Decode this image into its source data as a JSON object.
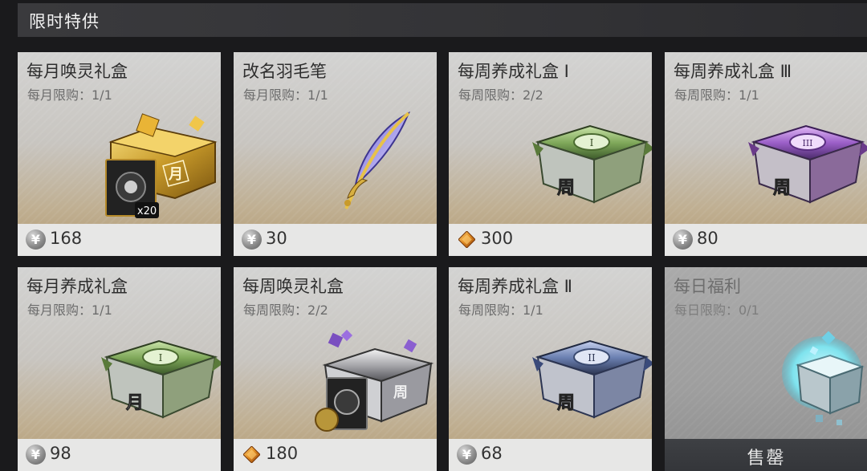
{
  "section_title": "限时特供",
  "cards": [
    {
      "name": "每月唤灵礼盒",
      "limit": "每月限购：1/1",
      "currency": "yen-coin",
      "currency_symbol": "¥",
      "price": "168",
      "badge": "x20",
      "glyph": "月"
    },
    {
      "name": "改名羽毛笔",
      "limit": "每月限购：1/1",
      "currency": "yen-coin",
      "currency_symbol": "¥",
      "price": "30"
    },
    {
      "name": "每周养成礼盒 Ⅰ",
      "limit": "每周限购：2/2",
      "currency": "amber-gem",
      "price": "300",
      "glyph": "周"
    },
    {
      "name": "每周养成礼盒 Ⅲ",
      "limit": "每周限购：1/1",
      "currency": "yen-coin",
      "currency_symbol": "¥",
      "price": "80",
      "glyph": "周"
    },
    {
      "name": "每月养成礼盒",
      "limit": "每月限购：1/1",
      "currency": "yen-coin",
      "currency_symbol": "¥",
      "price": "98",
      "glyph": "月"
    },
    {
      "name": "每周唤灵礼盒",
      "limit": "每周限购：2/2",
      "currency": "amber-gem",
      "price": "180",
      "glyph": "周"
    },
    {
      "name": "每周养成礼盒 Ⅱ",
      "limit": "每周限购：1/1",
      "currency": "yen-coin",
      "currency_symbol": "¥",
      "price": "68",
      "glyph": "周"
    },
    {
      "name": "每日福利",
      "limit": "每日限购：0/1",
      "sold_out_label": "售罄"
    }
  ],
  "colors": {
    "gold_chest": "#c89a2a",
    "green_chest": "#7fa85a",
    "purple_chest": "#9b5fc8",
    "blue_chest": "#6a7fb0",
    "violet_chest": "#7a4fc0",
    "cyan_glow": "#7fe3ee",
    "gem": "#e08a20"
  }
}
